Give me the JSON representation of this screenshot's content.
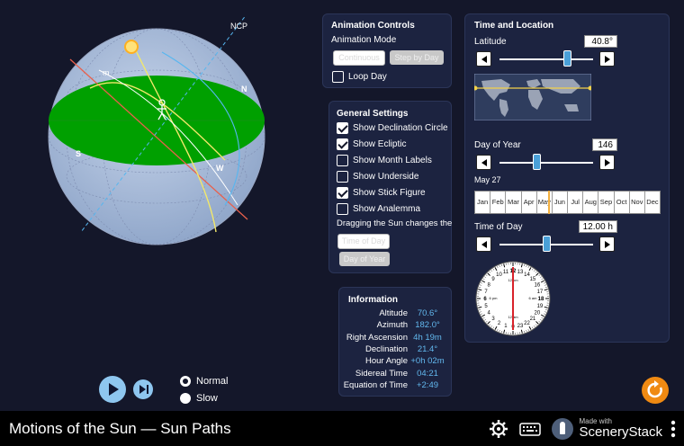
{
  "footer": {
    "title": "Motions of the Sun — Sun Paths",
    "brand_made": "Made with",
    "brand_name": "SceneryStack"
  },
  "sphere": {
    "ncp_label": "NCP",
    "n_label": "N",
    "s_label": "S",
    "w_label": "W",
    "m_label": "m"
  },
  "animation": {
    "title": "Animation Controls",
    "mode_label": "Animation Mode",
    "continuous": "Continuous",
    "step_by_day": "Step by Day",
    "loop_day": "Loop Day",
    "loop_day_checked": false
  },
  "settings": {
    "title": "General Settings",
    "items": [
      {
        "label": "Show Declination Circle",
        "checked": true
      },
      {
        "label": "Show Ecliptic",
        "checked": true
      },
      {
        "label": "Show Month Labels",
        "checked": false
      },
      {
        "label": "Show Underside",
        "checked": false
      },
      {
        "label": "Show Stick Figure",
        "checked": true
      },
      {
        "label": "Show Analemma",
        "checked": false
      }
    ],
    "drag_label": "Dragging the Sun changes the",
    "time_of_day_btn": "Time of Day",
    "day_of_year_btn": "Day of Year"
  },
  "info": {
    "title": "Information",
    "rows": [
      {
        "key": "Altitude",
        "value": "70.6°"
      },
      {
        "key": "Azimuth",
        "value": "182.0°"
      },
      {
        "key": "Right Ascension",
        "value": "4h 19m"
      },
      {
        "key": "Declination",
        "value": "21.4°"
      },
      {
        "key": "Hour Angle",
        "value": "+0h 02m"
      },
      {
        "key": "Sidereal Time",
        "value": "04:21"
      },
      {
        "key": "Equation of Time",
        "value": "+2:49"
      }
    ]
  },
  "time_location": {
    "title": "Time and Location",
    "latitude_label": "Latitude",
    "latitude_value": "40.8°",
    "latitude_fraction": 0.73,
    "day_label": "Day of Year",
    "day_value": "146",
    "day_fraction": 0.4,
    "date_label": "May 27",
    "months": [
      "Jan",
      "Feb",
      "Mar",
      "Apr",
      "May",
      "Jun",
      "Jul",
      "Aug",
      "Sep",
      "Oct",
      "Nov",
      "Dec"
    ],
    "time_label": "Time of Day",
    "time_value": "12.00 h",
    "time_fraction": 0.5,
    "clock_labels": [
      "12 pm",
      "6 pm",
      "6 am",
      "12 am"
    ]
  },
  "speed": {
    "normal": "Normal",
    "slow": "Slow",
    "selected": "Normal"
  },
  "colors": {
    "accent": "#4aa0d8",
    "panel": "#1c2340",
    "horizon": "#00a000",
    "value_text": "#62b8ee",
    "reset": "#f08a12"
  }
}
